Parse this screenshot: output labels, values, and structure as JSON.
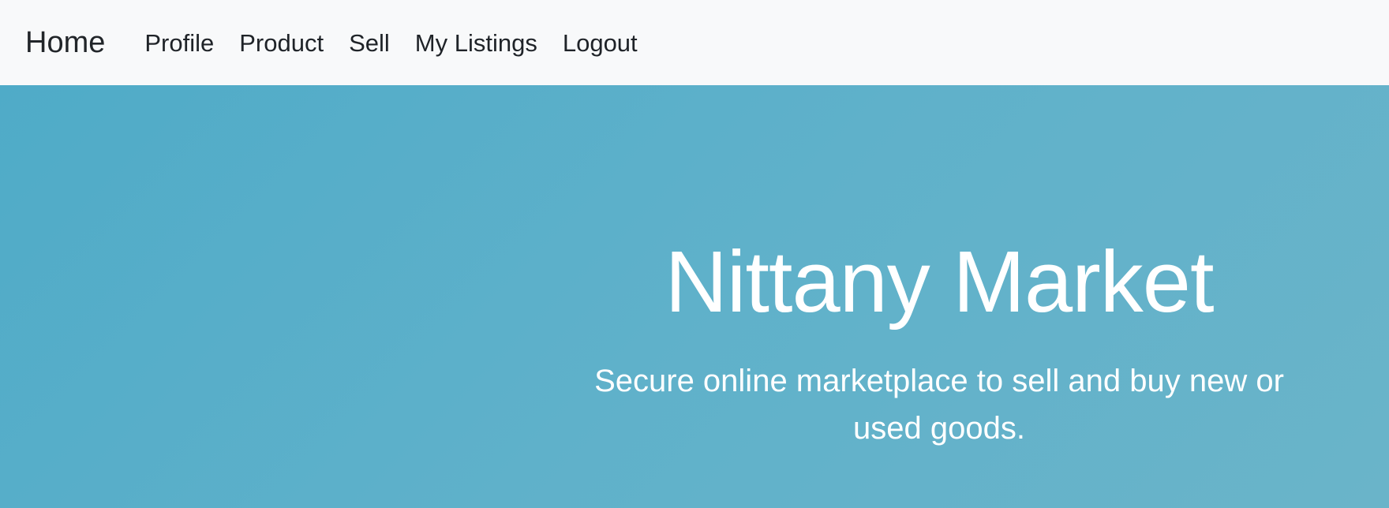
{
  "navbar": {
    "brand": "Home",
    "links": [
      {
        "label": "Profile"
      },
      {
        "label": "Product"
      },
      {
        "label": "Sell"
      },
      {
        "label": "My Listings"
      },
      {
        "label": "Logout"
      }
    ]
  },
  "hero": {
    "title": "Nittany Market",
    "subtitle": "Secure online marketplace to sell and buy new or used goods."
  },
  "colors": {
    "navbar_bg": "#f8f9fa",
    "hero_bg": "#5fb0c8",
    "hero_text": "#ffffff",
    "nav_text": "#212529"
  }
}
